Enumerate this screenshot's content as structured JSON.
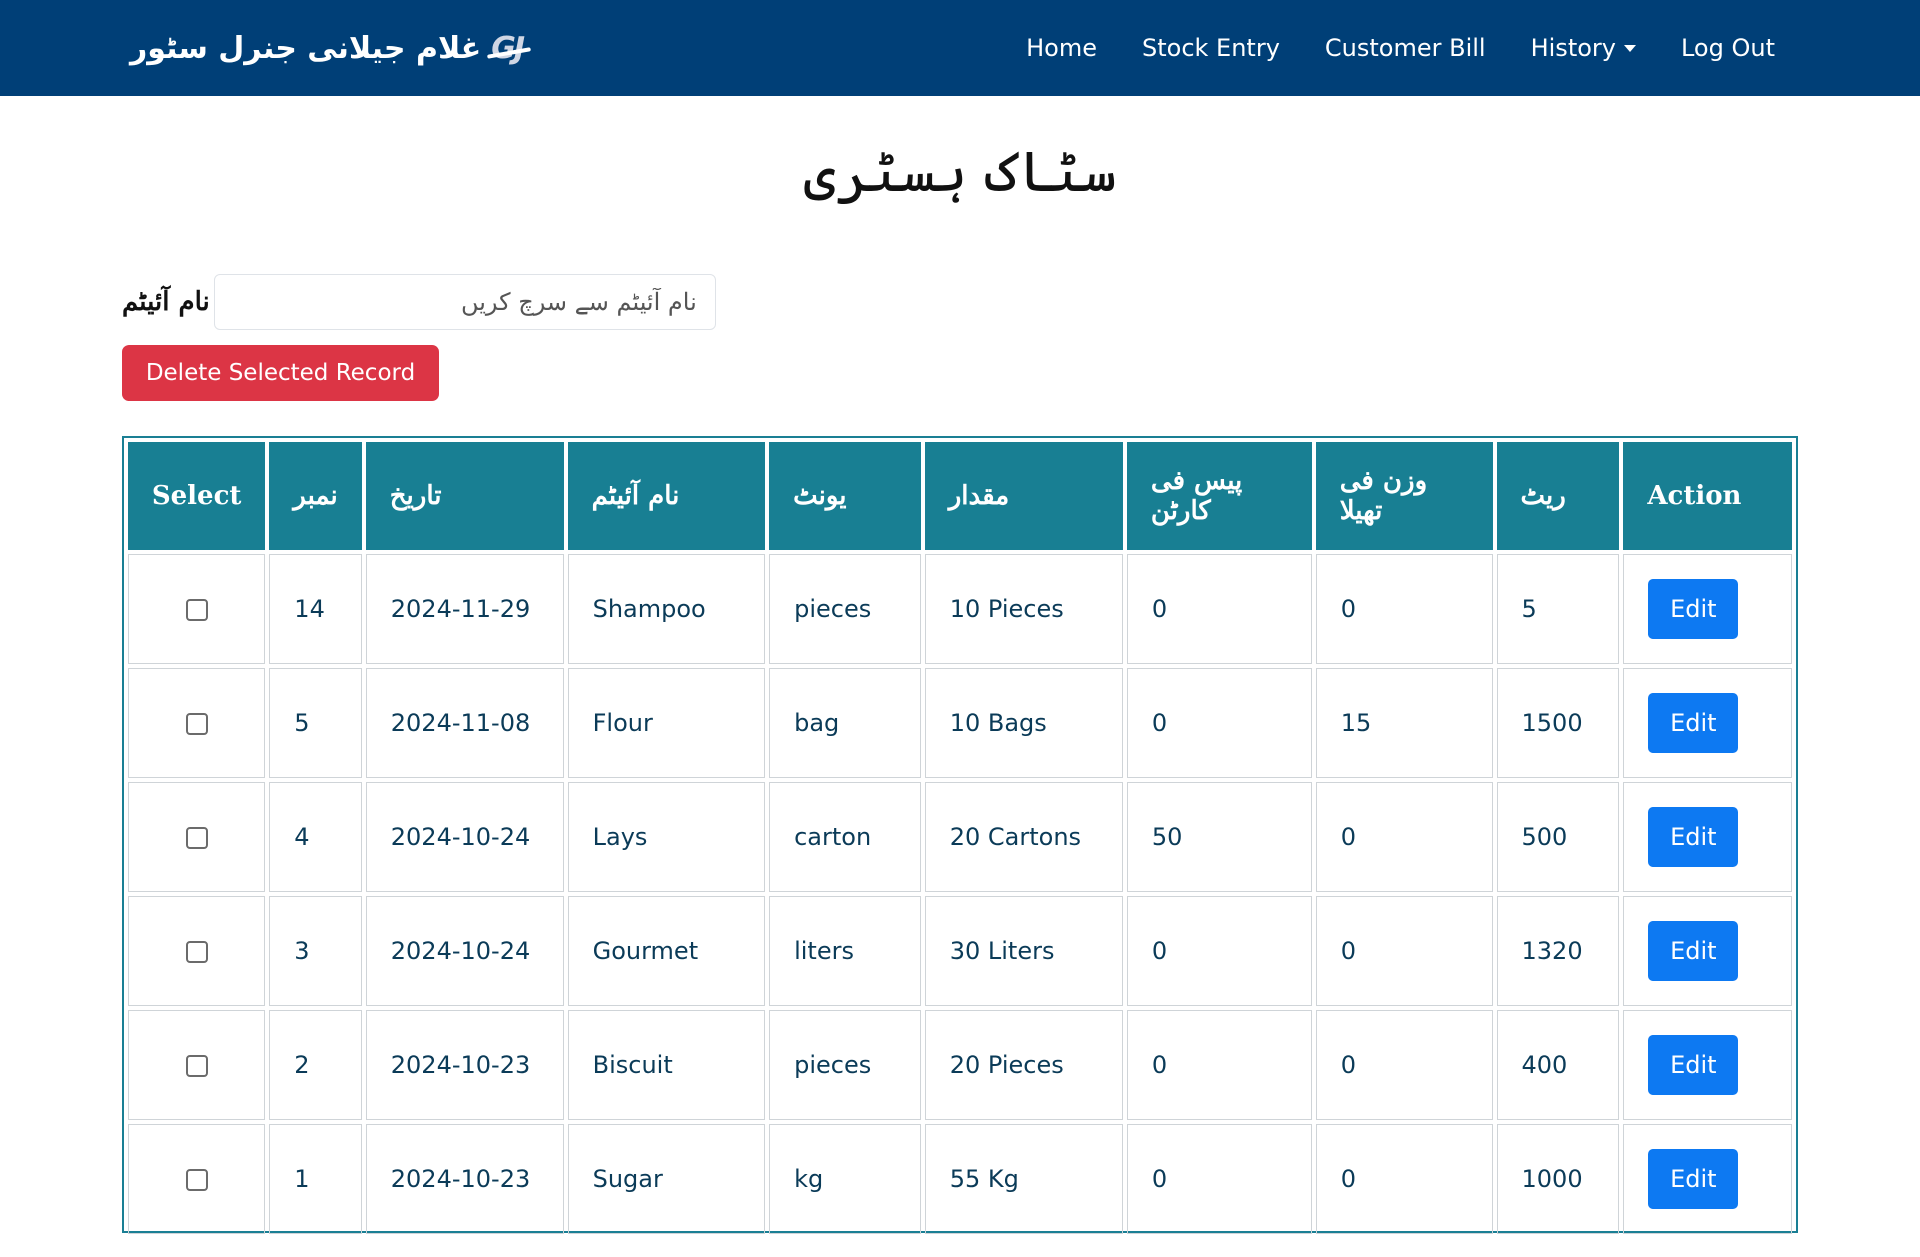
{
  "navbar": {
    "brand_logo": "GJ",
    "brand_text": "غلام جیلانی جنرل سٹور",
    "links": [
      "Home",
      "Stock Entry",
      "Customer Bill",
      "History",
      "Log Out"
    ]
  },
  "page": {
    "title": "سٹاک ہسٹری"
  },
  "search": {
    "label": "نام آئیٹم",
    "placeholder": "نام آئیٹم سے سرچ کریں"
  },
  "actions": {
    "delete_selected": "Delete Selected Record"
  },
  "table": {
    "headers": [
      "Select",
      "نمبر",
      "تاریخ",
      "نام آئیٹم",
      "یونٹ",
      "مقدار",
      "پیس فی کارٹن",
      "وزن فی تھیلا",
      "ریٹ",
      "Action"
    ],
    "edit_label": "Edit",
    "rows": [
      {
        "number": "14",
        "date": "2024-11-29",
        "item": "Shampoo",
        "unit": "pieces",
        "quantity": "10 Pieces",
        "pieces_per_carton": "0",
        "weight_per_bag": "0",
        "rate": "5"
      },
      {
        "number": "5",
        "date": "2024-11-08",
        "item": "Flour",
        "unit": "bag",
        "quantity": "10 Bags",
        "pieces_per_carton": "0",
        "weight_per_bag": "15",
        "rate": "1500"
      },
      {
        "number": "4",
        "date": "2024-10-24",
        "item": "Lays",
        "unit": "carton",
        "quantity": "20 Cartons",
        "pieces_per_carton": "50",
        "weight_per_bag": "0",
        "rate": "500"
      },
      {
        "number": "3",
        "date": "2024-10-24",
        "item": "Gourmet",
        "unit": "liters",
        "quantity": "30 Liters",
        "pieces_per_carton": "0",
        "weight_per_bag": "0",
        "rate": "1320"
      },
      {
        "number": "2",
        "date": "2024-10-23",
        "item": "Biscuit",
        "unit": "pieces",
        "quantity": "20 Pieces",
        "pieces_per_carton": "0",
        "weight_per_bag": "0",
        "rate": "400"
      },
      {
        "number": "1",
        "date": "2024-10-23",
        "item": "Sugar",
        "unit": "kg",
        "quantity": "55 Kg",
        "pieces_per_carton": "0",
        "weight_per_bag": "0",
        "rate": "1000"
      }
    ]
  },
  "colors": {
    "navbar": "#003f77",
    "table_header": "#187f93",
    "delete_button": "#dc3545",
    "edit_button": "#0d79f2"
  }
}
